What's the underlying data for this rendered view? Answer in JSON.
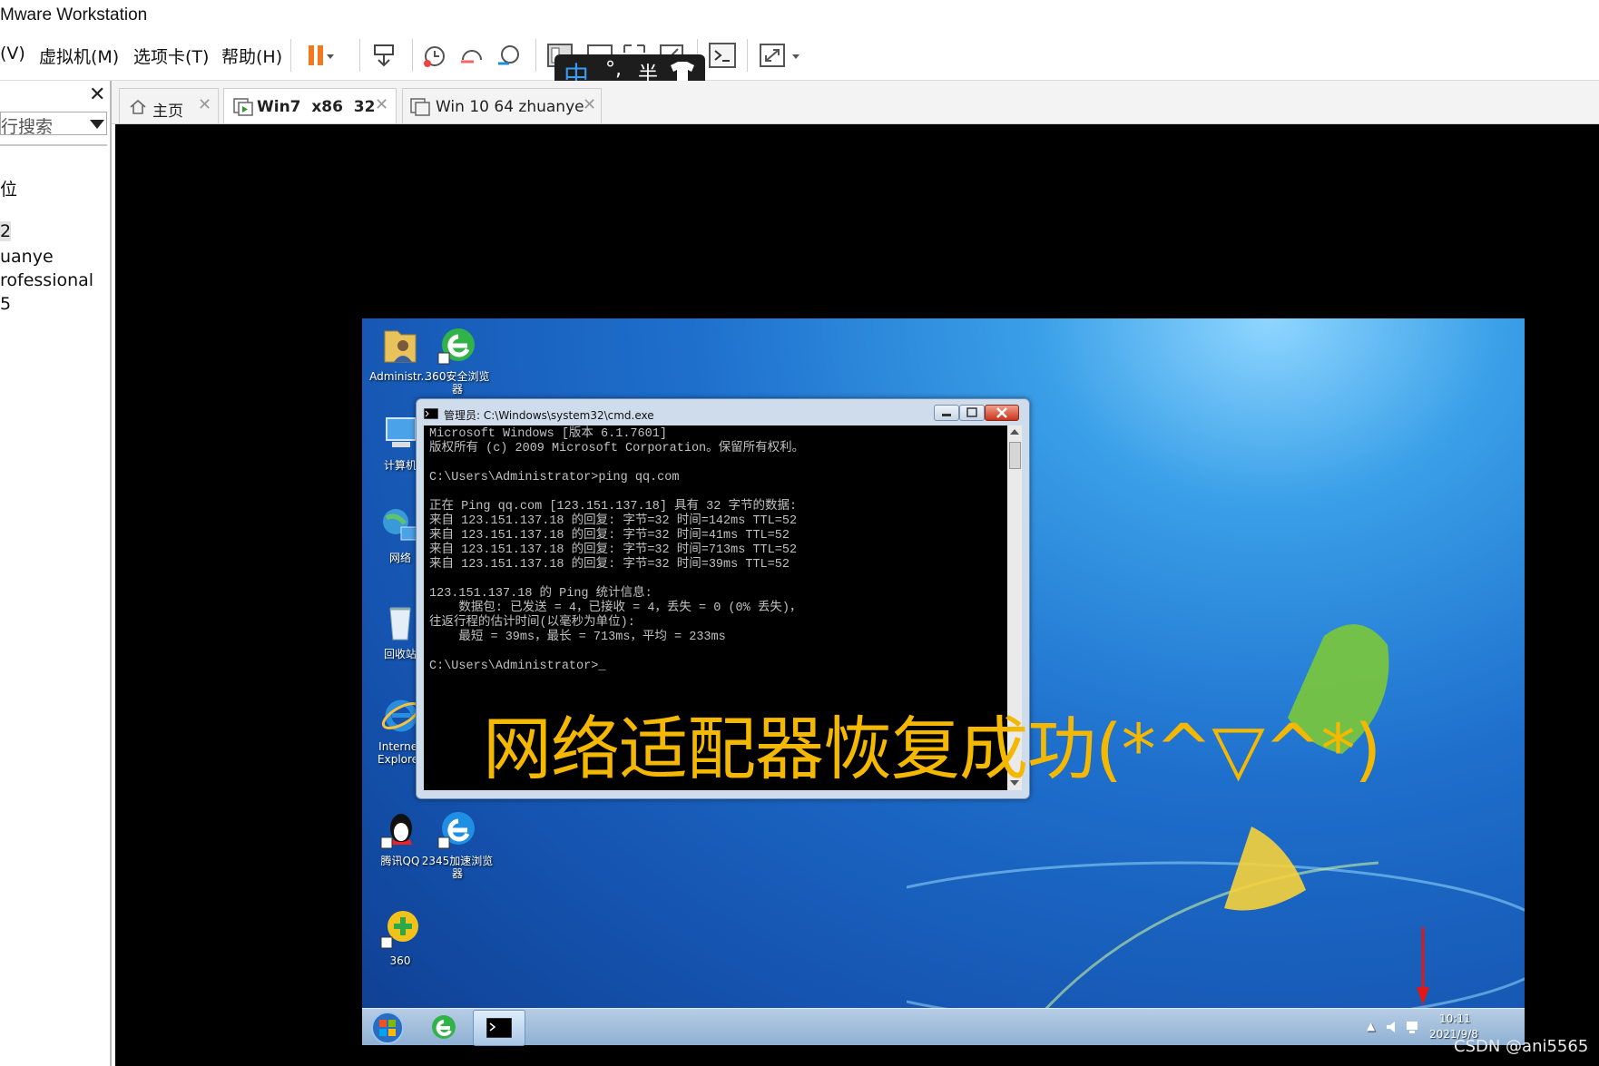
{
  "app": {
    "title": "Mware Workstation"
  },
  "menu": {
    "items": [
      "(V)",
      "虚拟机(M)",
      "选项卡(T)",
      "帮助(H)"
    ]
  },
  "ime": {
    "mode_char": "中",
    "punct": "°,",
    "width": "半"
  },
  "sidebar": {
    "search_placeholder": "行搜索",
    "items": [
      "位",
      "2",
      "uanye",
      "rofessional",
      "5"
    ]
  },
  "tabs": [
    {
      "label": "主页",
      "active": false
    },
    {
      "label": "Win7  x86  32",
      "active": true
    },
    {
      "label": "Win 10 64 zhuanye",
      "active": false
    }
  ],
  "desktop": {
    "icons": [
      {
        "label": "Administr..."
      },
      {
        "label": "360安全浏览器"
      },
      {
        "label": "计算机"
      },
      {
        "label": "网络"
      },
      {
        "label": "回收站"
      },
      {
        "label": "Internet Explorer"
      },
      {
        "label": "腾讯QQ"
      },
      {
        "label": "2345加速浏览器"
      },
      {
        "label": "360"
      }
    ]
  },
  "cmd": {
    "title": "管理员: C:\\Windows\\system32\\cmd.exe",
    "lines": [
      "Microsoft Windows [版本 6.1.7601]",
      "版权所有 (c) 2009 Microsoft Corporation。保留所有权利。",
      "",
      "C:\\Users\\Administrator>ping qq.com",
      "",
      "正在 Ping qq.com [123.151.137.18] 具有 32 字节的数据:",
      "来自 123.151.137.18 的回复: 字节=32 时间=142ms TTL=52",
      "来自 123.151.137.18 的回复: 字节=32 时间=41ms TTL=52",
      "来自 123.151.137.18 的回复: 字节=32 时间=713ms TTL=52",
      "来自 123.151.137.18 的回复: 字节=32 时间=39ms TTL=52",
      "",
      "123.151.137.18 的 Ping 统计信息:",
      "    数据包: 已发送 = 4，已接收 = 4，丢失 = 0 (0% 丢失)，",
      "往返行程的估计时间(以毫秒为单位):",
      "    最短 = 39ms，最长 = 713ms，平均 = 233ms",
      "",
      "C:\\Users\\Administrator>_"
    ]
  },
  "caption": "网络适配器恢复成功(*^▽^*)",
  "taskbar": {
    "time": "10:11",
    "date": "2021/9/8"
  },
  "watermark": "CSDN @ani5565",
  "colors": {
    "caption": "#f5b800",
    "desktop": "#1e6fcc",
    "pause": "#f07a21"
  }
}
